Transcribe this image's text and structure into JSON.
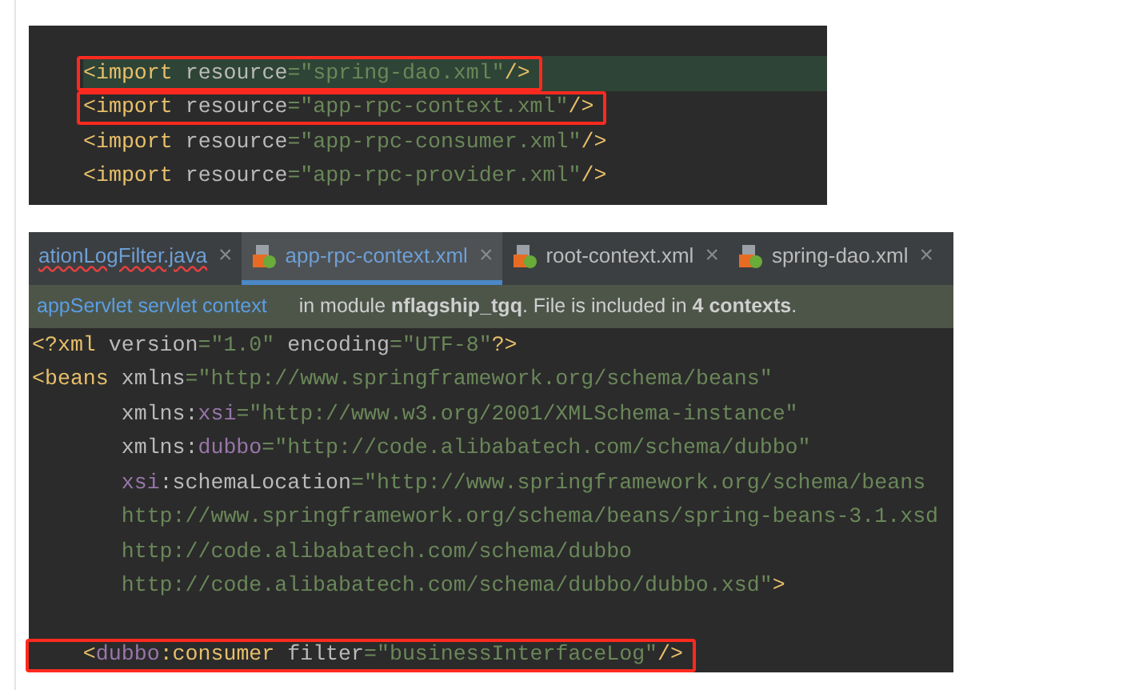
{
  "snippet_1": {
    "lines": [
      {
        "highlighted": true,
        "boxed": true,
        "segments": [
          {
            "kind": "tag",
            "text": "<import"
          },
          {
            "kind": "attr",
            "text": " resource"
          },
          {
            "kind": "value",
            "text": "=\"spring-dao.xml\""
          },
          {
            "kind": "tag",
            "text": "/>"
          }
        ]
      },
      {
        "highlighted": false,
        "boxed": true,
        "segments": [
          {
            "kind": "tag",
            "text": "<import"
          },
          {
            "kind": "attr",
            "text": " resource"
          },
          {
            "kind": "value",
            "text": "=\"app-rpc-context.xml\""
          },
          {
            "kind": "tag",
            "text": "/>"
          }
        ]
      },
      {
        "highlighted": false,
        "boxed": false,
        "segments": [
          {
            "kind": "tag",
            "text": "<import"
          },
          {
            "kind": "attr",
            "text": " resource"
          },
          {
            "kind": "value",
            "text": "=\"app-rpc-consumer.xml\""
          },
          {
            "kind": "tag",
            "text": "/>"
          }
        ]
      },
      {
        "highlighted": false,
        "boxed": false,
        "segments": [
          {
            "kind": "tag",
            "text": "<import"
          },
          {
            "kind": "attr",
            "text": " resource"
          },
          {
            "kind": "value",
            "text": "=\"app-rpc-provider.xml\""
          },
          {
            "kind": "tag",
            "text": "/>"
          }
        ]
      }
    ]
  },
  "editor": {
    "tabs": [
      {
        "label": "ationLogFilter.java",
        "kind": "java",
        "error": true,
        "selected": false,
        "close": "×"
      },
      {
        "label": "app-rpc-context.xml",
        "kind": "xml",
        "error": false,
        "selected": true,
        "close": "×"
      },
      {
        "label": "root-context.xml",
        "kind": "xml",
        "error": false,
        "selected": false,
        "close": "×"
      },
      {
        "label": "spring-dao.xml",
        "kind": "xml",
        "error": false,
        "selected": false,
        "close": "×"
      }
    ],
    "banner": {
      "link": "appServlet servlet context",
      "message": "in module **nflagship_tgq**. File is included in **4 contexts**."
    },
    "lines": [
      {
        "highlighted": false,
        "boxed": false,
        "segments": [
          {
            "kind": "tag",
            "text": "<?xml"
          },
          {
            "kind": "attr",
            "text": " version"
          },
          {
            "kind": "value",
            "text": "=\"1.0\""
          },
          {
            "kind": "attr",
            "text": " encoding"
          },
          {
            "kind": "value",
            "text": "=\"UTF-8\""
          },
          {
            "kind": "tag",
            "text": "?>"
          }
        ]
      },
      {
        "highlighted": false,
        "boxed": false,
        "segments": [
          {
            "kind": "tag",
            "text": "<beans"
          },
          {
            "kind": "attr",
            "text": " xmlns"
          },
          {
            "kind": "value",
            "text": "=\"http://www.springframework.org/schema/beans\""
          }
        ]
      },
      {
        "highlighted": false,
        "boxed": false,
        "segments": [
          {
            "kind": "attr",
            "text": "       xmlns:"
          },
          {
            "kind": "ns",
            "text": "xsi"
          },
          {
            "kind": "value",
            "text": "=\"http://www.w3.org/2001/XMLSchema-instance\""
          }
        ]
      },
      {
        "highlighted": false,
        "boxed": false,
        "segments": [
          {
            "kind": "attr",
            "text": "       xmlns:"
          },
          {
            "kind": "ns",
            "text": "dubbo"
          },
          {
            "kind": "value",
            "text": "=\"http://code.alibabatech.com/schema/dubbo\""
          }
        ]
      },
      {
        "highlighted": false,
        "boxed": false,
        "segments": [
          {
            "kind": "ns",
            "text": "       xsi"
          },
          {
            "kind": "attr",
            "text": ":schemaLocation"
          },
          {
            "kind": "value",
            "text": "=\"http://www.springframework.org/schema/beans"
          }
        ]
      },
      {
        "highlighted": false,
        "boxed": false,
        "segments": [
          {
            "kind": "value",
            "text": "       http://www.springframework.org/schema/beans/spring-beans-3.1.xsd"
          }
        ]
      },
      {
        "highlighted": false,
        "boxed": false,
        "segments": [
          {
            "kind": "value",
            "text": "       http://code.alibabatech.com/schema/dubbo"
          }
        ]
      },
      {
        "highlighted": false,
        "boxed": false,
        "segments": [
          {
            "kind": "value",
            "text": "       http://code.alibabatech.com/schema/dubbo/dubbo.xsd\""
          },
          {
            "kind": "tag",
            "text": ">"
          }
        ]
      },
      {
        "highlighted": false,
        "boxed": false
      },
      {
        "highlighted": false,
        "boxed": true,
        "segments": [
          {
            "kind": "tag",
            "text": "    <"
          },
          {
            "kind": "ns",
            "text": "dubbo"
          },
          {
            "kind": "tag",
            "text": ":consumer"
          },
          {
            "kind": "attr",
            "text": " filter"
          },
          {
            "kind": "value",
            "text": "=\"businessInterfaceLog\""
          },
          {
            "kind": "tag",
            "text": "/>"
          }
        ]
      }
    ]
  }
}
